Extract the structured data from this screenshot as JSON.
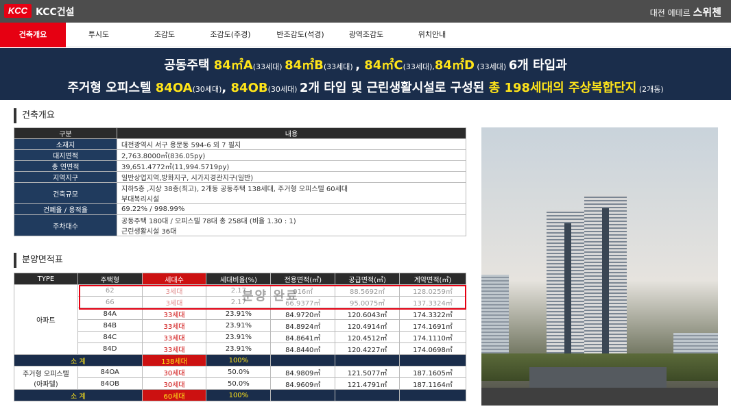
{
  "header": {
    "logo_mark": "KCC",
    "logo_text": "KCC건설",
    "brand_prefix": "대전 에테르 ",
    "brand_name": "스위첸"
  },
  "nav": {
    "tabs": [
      {
        "label": "건축개요",
        "active": true
      },
      {
        "label": "투시도",
        "active": false
      },
      {
        "label": "조감도",
        "active": false
      },
      {
        "label": "조감도(주경)",
        "active": false
      },
      {
        "label": "반조감도(석경)",
        "active": false
      },
      {
        "label": "광역조감도",
        "active": false
      },
      {
        "label": "위치안내",
        "active": false
      }
    ]
  },
  "banner": {
    "l1_a": "공동주택 ",
    "l1_t1": "84㎡A",
    "l1_s1": "(33세대) ",
    "l1_t2": "84㎡B",
    "l1_s2": "(33세대) ",
    "l1_c": ", ",
    "l1_t3": "84㎡C",
    "l1_s3": "(33세대),",
    "l1_t4": "84㎡D",
    "l1_s4": " (33세대) ",
    "l1_end": " 6개 타입과",
    "l2_a": "주거형 오피스텔 ",
    "l2_t1": "84OA",
    "l2_s1": "(30세대)",
    "l2_c": ", ",
    "l2_t2": "84OB",
    "l2_s2": "(30세대) ",
    "l2_mid": "2개 타입 및 근린생활시설로 구성된 ",
    "l2_hl": "총 198세대의 주상복합단지",
    "l2_s3": " (2개동)"
  },
  "spec": {
    "title": "건축개요",
    "headers": [
      "구분",
      "내용"
    ],
    "rows": [
      {
        "label": "소재지",
        "value": "대전광역시 서구 용문동 594-6 외 7 필지"
      },
      {
        "label": "대지면적",
        "value": "2,763.8000㎡(836.05py)"
      },
      {
        "label": "총 연면적",
        "value": "39,651.4772㎡(11,994.5719py)"
      },
      {
        "label": "지역지구",
        "value": "일반상업지역,방화지구, 시가지경관지구(일반)"
      },
      {
        "label": "건축규모",
        "value": "지하5층 ,지상 38층(최고), 2개동 공동주택 138세대, 주거형 오피스텔 60세대",
        "value2": "부대복리시설"
      },
      {
        "label": "건폐율 / 용적율",
        "value": "69.22% / 998.99%"
      },
      {
        "label": "주차대수",
        "value": "공동주택 180대 / 오피스텔 78대 총 258대   (비율 1.30 : 1)",
        "value2": "근린생활시설 36대"
      }
    ]
  },
  "area": {
    "title": "분양면적표",
    "headers": [
      "TYPE",
      "주택형",
      "세대수",
      "세대비율(%)",
      "전용면적(㎡)",
      "공급면적(㎡)",
      "계약면적(㎡)"
    ],
    "apt_label": "아파트",
    "apt_rows": [
      {
        "type": "62",
        "units": "3세대",
        "ratio": "2.17",
        "net": "016㎡",
        "supply": "88.5692㎡",
        "contract": "128.0259㎡",
        "faded": true
      },
      {
        "type": "66",
        "units": "3세대",
        "ratio": "2.17",
        "net": "66.9377㎡",
        "supply": "95.0075㎡",
        "contract": "137.3324㎡",
        "faded": true
      },
      {
        "type": "84A",
        "units": "33세대",
        "ratio": "23.91%",
        "net": "84.9720㎡",
        "supply": "120.6043㎡",
        "contract": "174.3322㎡",
        "faded": false
      },
      {
        "type": "84B",
        "units": "33세대",
        "ratio": "23.91%",
        "net": "84.8924㎡",
        "supply": "120.4914㎡",
        "contract": "174.1691㎡",
        "faded": false
      },
      {
        "type": "84C",
        "units": "33세대",
        "ratio": "23.91%",
        "net": "84.8641㎡",
        "supply": "120.4512㎡",
        "contract": "174.1110㎡",
        "faded": false
      },
      {
        "type": "84D",
        "units": "33세대",
        "ratio": "23.91%",
        "net": "84.8440㎡",
        "supply": "120.4227㎡",
        "contract": "174.0698㎡",
        "faded": false
      }
    ],
    "subtotal1": {
      "label": "소 계",
      "units": "138세대",
      "ratio": "100%"
    },
    "off_label1": "주거형 오피스텔",
    "off_label2": "(아파텔)",
    "off_rows": [
      {
        "type": "84OA",
        "units": "30세대",
        "ratio": "50.0%",
        "net": "84.9809㎡",
        "supply": "121.5077㎡",
        "contract": "187.1605㎡"
      },
      {
        "type": "84OB",
        "units": "30세대",
        "ratio": "50.0%",
        "net": "84.9609㎡",
        "supply": "121.4791㎡",
        "contract": "187.1164㎡"
      }
    ],
    "subtotal2": {
      "label": "소 계",
      "units": "60세대",
      "ratio": "100%"
    },
    "watermark": "분양 완료"
  },
  "colors": {
    "accent_red": "#e60012",
    "navy": "#1a2d4b",
    "highlight_yellow": "#ffe419"
  }
}
